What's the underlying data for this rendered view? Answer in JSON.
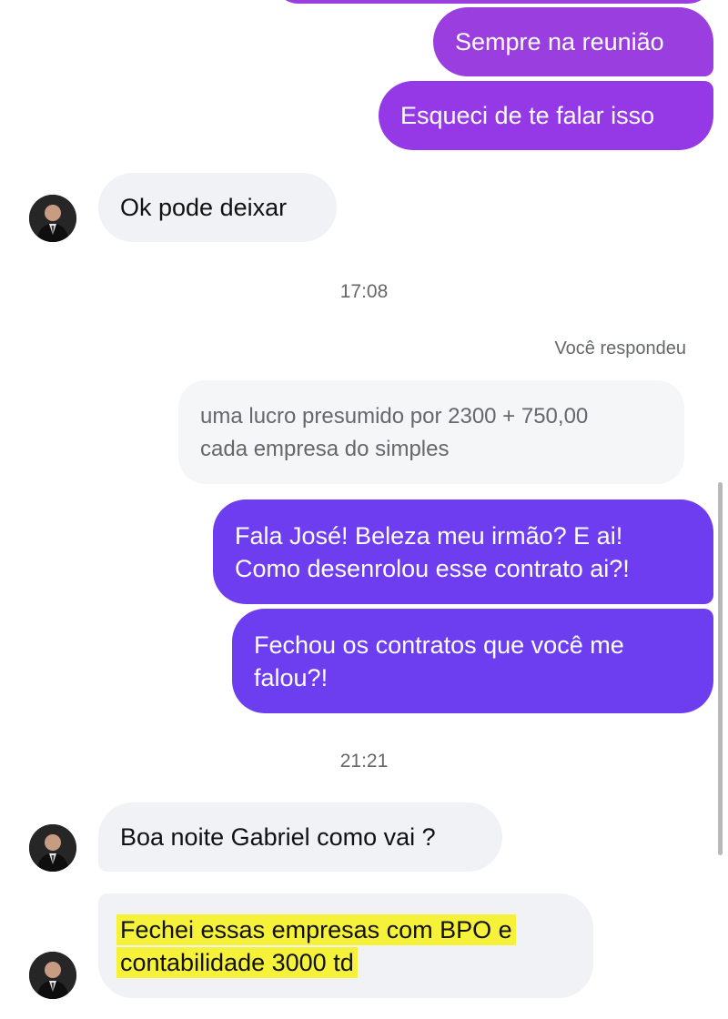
{
  "colors": {
    "outgoing_purple": "#9a3ee0",
    "outgoing_violet": "#6f3df0",
    "incoming_bg": "#f0f2f5",
    "highlight": "#f6f23a"
  },
  "messages": {
    "out1": "Sempre na reunião",
    "out2": "Esqueci de te falar isso",
    "in1": "Ok pode deixar",
    "time1": "17:08",
    "reply_label": "Você respondeu",
    "quoted_line1": "uma lucro presumido por 2300 + 750,00",
    "quoted_line2": "cada empresa do simples",
    "out3_line1": "Fala José! Beleza meu irmão? E ai!",
    "out3_line2": "Como desenrolou esse contrato ai?!",
    "out4_line1": "Fechou os contratos que você me",
    "out4_line2": "falou?!",
    "time2": "21:21",
    "in2": "Boa noite Gabriel como vai ?",
    "in3_line1": "Fechei essas empresas com BPO e",
    "in3_line2": "contabilidade 3000 td"
  }
}
